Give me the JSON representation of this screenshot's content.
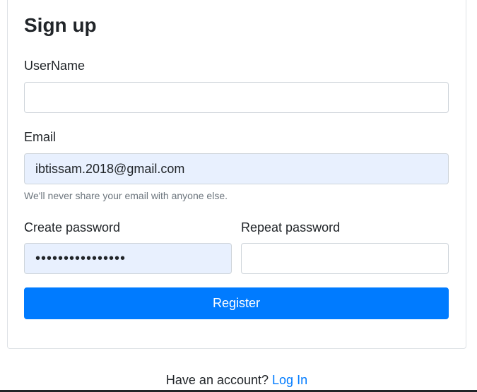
{
  "form": {
    "title": "Sign up",
    "username": {
      "label": "UserName",
      "value": ""
    },
    "email": {
      "label": "Email",
      "value": "ibtissam.2018@gmail.com",
      "help": "We'll never share your email with anyone else."
    },
    "create_password": {
      "label": "Create password",
      "value": "••••••••••••••••"
    },
    "repeat_password": {
      "label": "Repeat password",
      "value": ""
    },
    "register_label": "Register"
  },
  "footer": {
    "prompt": "Have an account?",
    "login_label": "Log In"
  },
  "colors": {
    "primary": "#007bff",
    "autofill_bg": "#e8f0fe",
    "help_text": "#6c757d"
  }
}
